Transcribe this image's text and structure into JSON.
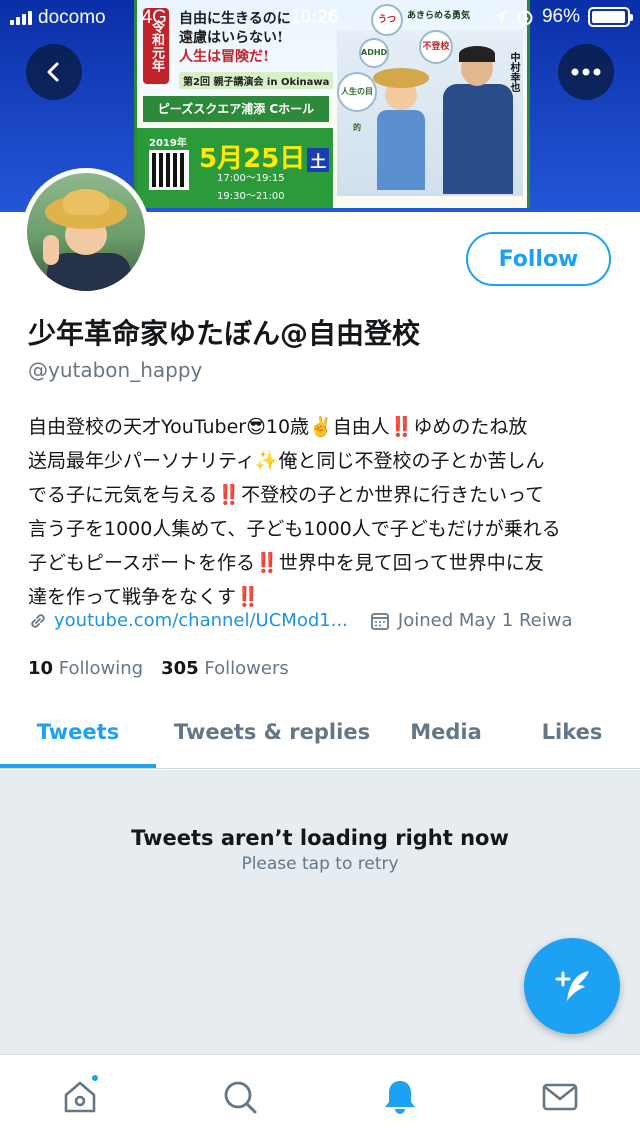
{
  "status_bar": {
    "carrier": "docomo",
    "network": "4G",
    "time": "10:26",
    "battery": "96%",
    "battery_level": 0.96
  },
  "banner": {
    "year_badge": "令和元年",
    "title_line1": "自由に生きるのに",
    "title_line2": "遠慮はいらない!",
    "title_line3": "人生は冒険だ!",
    "subtitle": "第2回 親子講演会 in Okinawa",
    "venue": "ピーズスクエア浦添 Cホール",
    "date_year": "2019年",
    "date": "5月25日",
    "day_of_week": "土",
    "time_lecture": "17:00〜19:15",
    "time_social": "19:30〜21:00",
    "tagline": "あきらめる勇気",
    "name_right": "中村幸也",
    "bubble_labels": [
      "うつ",
      "ADHD",
      "不登校",
      "人生の目的"
    ],
    "brand_color": "#1a47c4"
  },
  "profile": {
    "name": "少年革命家ゆたぼん@自由登校",
    "handle": "@yutabon_happy",
    "follow_label": "Follow",
    "bio": "自由登校の天才YouTuber😎10歳✌️自由人‼️ゆめのたね放\n送局最年少パーソナリティ✨俺と同じ不登校の子とか苦しん\nでる子に元気を与える‼️不登校の子とか世界に行きたいって\n言う子を1000人集めて、子ども1000人で子どもだけが乗れる\n子どもピースボートを作る‼️世界中を見て回って世界中に友\n達を作って戦争をなくす‼️",
    "link": "youtube.com/channel/UCMod1...",
    "joined": "Joined May 1 Reiwa",
    "following_count": "10",
    "following_label": "Following",
    "followers_count": "305",
    "followers_label": "Followers"
  },
  "tabs": [
    {
      "label": "Tweets",
      "active": true
    },
    {
      "label": "Tweets & replies",
      "active": false
    },
    {
      "label": "Media",
      "active": false
    },
    {
      "label": "Likes",
      "active": false
    }
  ],
  "feed": {
    "error_title": "Tweets aren’t loading right now",
    "error_sub": "Please tap to retry"
  },
  "bottom_nav": [
    "home-icon",
    "search-icon",
    "notifications-icon",
    "messages-icon"
  ],
  "colors": {
    "accent": "#1da1f2",
    "muted": "#657786",
    "text": "#14171a",
    "feed_bg": "#e6ecf0"
  }
}
